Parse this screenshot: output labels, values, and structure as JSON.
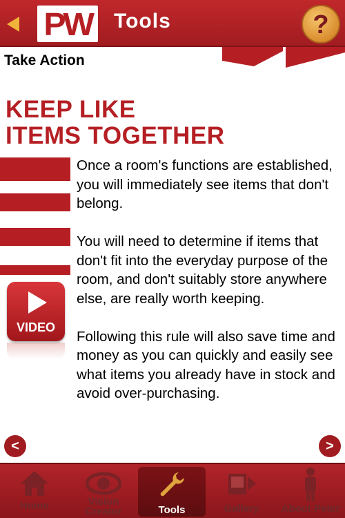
{
  "header": {
    "logo_text": "PW",
    "title": "Tools",
    "back_icon": "back-arrow-icon",
    "help_icon": "question-mark-icon"
  },
  "subheader": {
    "section_label": "Take Action"
  },
  "content": {
    "heading_line1": "KEEP LIKE",
    "heading_line2": "ITEMS TOGETHER",
    "paragraphs": [
      "Once a room's functions are established, you will immediately see items that don't belong.",
      "You will need to determine if items that don't fit into the everyday purpose of the room, and don't suitably store anywhere else, are really worth keeping.",
      "Following this rule will also save time and money as you can quickly and easily see what items you already have in stock and avoid over-purchasing."
    ],
    "video_label": "VIDEO",
    "prev_label": "<",
    "next_label": ">"
  },
  "tabbar": {
    "tabs": [
      {
        "label": "Home",
        "icon": "house-icon"
      },
      {
        "label": "Vision Creator",
        "icon": "eye-icon"
      },
      {
        "label": "Tools",
        "icon": "wrench-icon"
      },
      {
        "label": "Gallery",
        "icon": "photos-icon"
      },
      {
        "label": "About Peter",
        "icon": "person-icon"
      }
    ],
    "active_index": 2
  },
  "colors": {
    "brand_red": "#b51f24",
    "header_red": "#c0282b",
    "help_gold": "#e8a53a"
  }
}
